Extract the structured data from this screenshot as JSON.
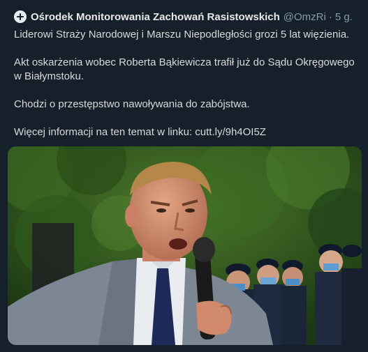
{
  "tweet": {
    "author_name": "Ośrodek Monitorowania Zachowań Rasistowskich",
    "handle": "@OmzRi",
    "separator": "·",
    "time": "5 g.",
    "paragraphs": [
      "Liderowi Straży Narodowej i Marszu Niepodległości grozi 5 lat więzienia.",
      "Akt oskarżenia wobec Roberta Bąkiewicza trafił już do Sądu Okręgowego w Białymstoku.",
      "Chodzi o przestępstwo nawoływania do zabójstwa.",
      "Więcej informacji na ten temat w linku: cutt.ly/9h4OI5Z"
    ],
    "media": {
      "icon": "photo-man-speaking-into-microphone",
      "colors": {
        "foliage": "#2f5a1f",
        "jacket": "#7d8794",
        "shirt": "#e9ecef",
        "tie": "#1e2a5a",
        "uniform": "#1b2538"
      }
    }
  },
  "colors": {
    "background": "#15202b",
    "text": "#d9d9d9",
    "muted": "#8899a6"
  }
}
